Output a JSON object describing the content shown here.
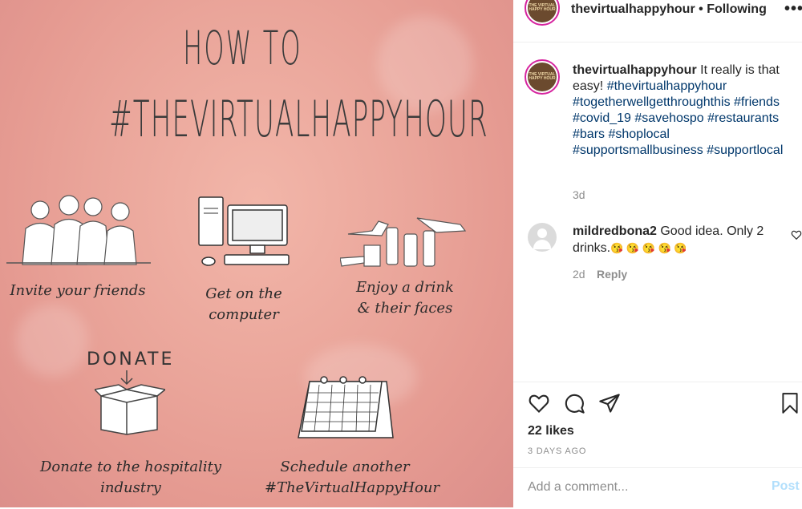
{
  "post_image": {
    "title_line1": "HOW TO",
    "title_line2": "#THEVIRTUALHAPPYHOUR",
    "step1": "Invite your friends",
    "step2": "Get on the computer",
    "step3_line1": "Enjoy a drink",
    "step3_line2": "& their faces",
    "donate_word": "DONATE",
    "step4_line1": "Donate to the hospitality",
    "step4_line2": "industry",
    "step5_line1": "Schedule another",
    "step5_line2": "#TheVirtualHappyHour"
  },
  "header": {
    "username": "thevirtualhappyhour",
    "separator": " • ",
    "follow_status": "Following",
    "more_icon": "more-options-icon",
    "avatar_text": "THE VIRTUAL HAPPY HOUR"
  },
  "caption": {
    "username": "thevirtualhappyhour",
    "text": "It really is that easy!",
    "hashtags": "#thevirtualhappyhour #togetherwellgetthroughthis #friends #covid_19 #savehospo #restaurants #bars #shoplocal #supportsmallbusiness #supportlocal",
    "time": "3d"
  },
  "comment": {
    "username": "mildredbona2",
    "text": "Good idea. Only 2 drinks.",
    "emojis": "😘 😘 😘 😘 😘",
    "time": "2d",
    "reply_label": "Reply"
  },
  "actions": {
    "likes": "22 likes",
    "ago": "3 DAYS AGO",
    "comment_placeholder": "Add a comment...",
    "post_label": "Post"
  },
  "colors": {
    "link": "#00376b",
    "muted": "#8e8e8e",
    "post_disabled": "#b2dffc",
    "image_bg": "#eaa59a"
  }
}
